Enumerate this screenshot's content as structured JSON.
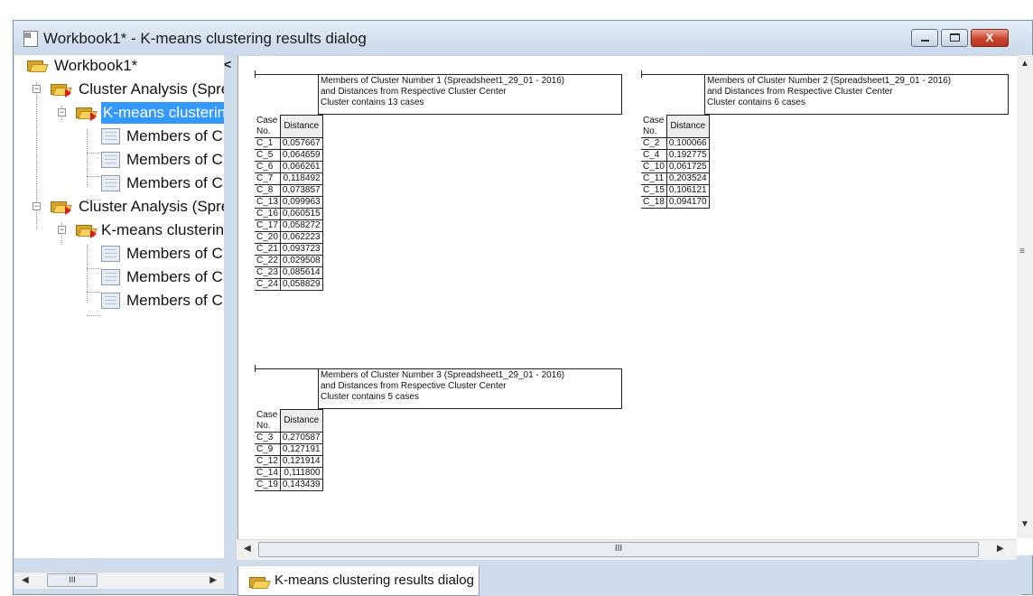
{
  "window": {
    "title": "Workbook1* - K-means clustering results dialog",
    "buttons": {
      "minimize": "minimize",
      "maximize": "maximize",
      "close": "X"
    }
  },
  "tree": {
    "root": "Workbook1*",
    "collapse_glyph": "<",
    "analyses": [
      {
        "label": "Cluster Analysis (Spre",
        "child": "K-means clusterin",
        "child_selected": true,
        "members": [
          "Members of C",
          "Members of C",
          "Members of C"
        ]
      },
      {
        "label": "Cluster Analysis (Spre",
        "child": "K-means clusterin",
        "child_selected": false,
        "members": [
          "Members of C",
          "Members of C",
          "Members of C"
        ]
      }
    ]
  },
  "scroll": {
    "grip": "III",
    "vgrip": "≡"
  },
  "tab": {
    "label": "K-means clustering results dialog"
  },
  "sheets": [
    {
      "title_lines": [
        "Members of Cluster Number 1 (Spreadsheet1_29_01 - 2016)",
        "and Distances from Respective Cluster Center",
        "Cluster contains 13 cases"
      ],
      "col_case": "Case No.",
      "col_distance": "Distance",
      "rows": [
        [
          "C_1",
          "0,057667"
        ],
        [
          "C_5",
          "0,064659"
        ],
        [
          "C_6",
          "0,066261"
        ],
        [
          "C_7",
          "0,118492"
        ],
        [
          "C_8",
          "0,073857"
        ],
        [
          "C_13",
          "0,099963"
        ],
        [
          "C_16",
          "0,060515"
        ],
        [
          "C_17",
          "0,058272"
        ],
        [
          "C_20",
          "0,062223"
        ],
        [
          "C_21",
          "0,093723"
        ],
        [
          "C_22",
          "0,029508"
        ],
        [
          "C_23",
          "0,085614"
        ],
        [
          "C_24",
          "0,058829"
        ]
      ]
    },
    {
      "title_lines": [
        "Members of Cluster Number 2 (Spreadsheet1_29_01 - 2016)",
        "and Distances from Respective Cluster Center",
        "Cluster contains 6 cases"
      ],
      "col_case": "Case No.",
      "col_distance": "Distance",
      "rows": [
        [
          "C_2",
          "0,100066"
        ],
        [
          "C_4",
          "0,192775"
        ],
        [
          "C_10",
          "0,061725"
        ],
        [
          "C_11",
          "0,203524"
        ],
        [
          "C_15",
          "0,106121"
        ],
        [
          "C_18",
          "0,094170"
        ]
      ]
    },
    {
      "title_lines": [
        "Members of Cluster Number 3 (Spreadsheet1_29_01 - 2016)",
        "and Distances from Respective Cluster Center",
        "Cluster contains 5 cases"
      ],
      "col_case": "Case No.",
      "col_distance": "Distance",
      "rows": [
        [
          "C_3",
          "0,270587"
        ],
        [
          "C_9",
          "0,127191"
        ],
        [
          "C_12",
          "0,121914"
        ],
        [
          "C_14",
          "0,111800"
        ],
        [
          "C_19",
          "0,143439"
        ]
      ]
    }
  ]
}
